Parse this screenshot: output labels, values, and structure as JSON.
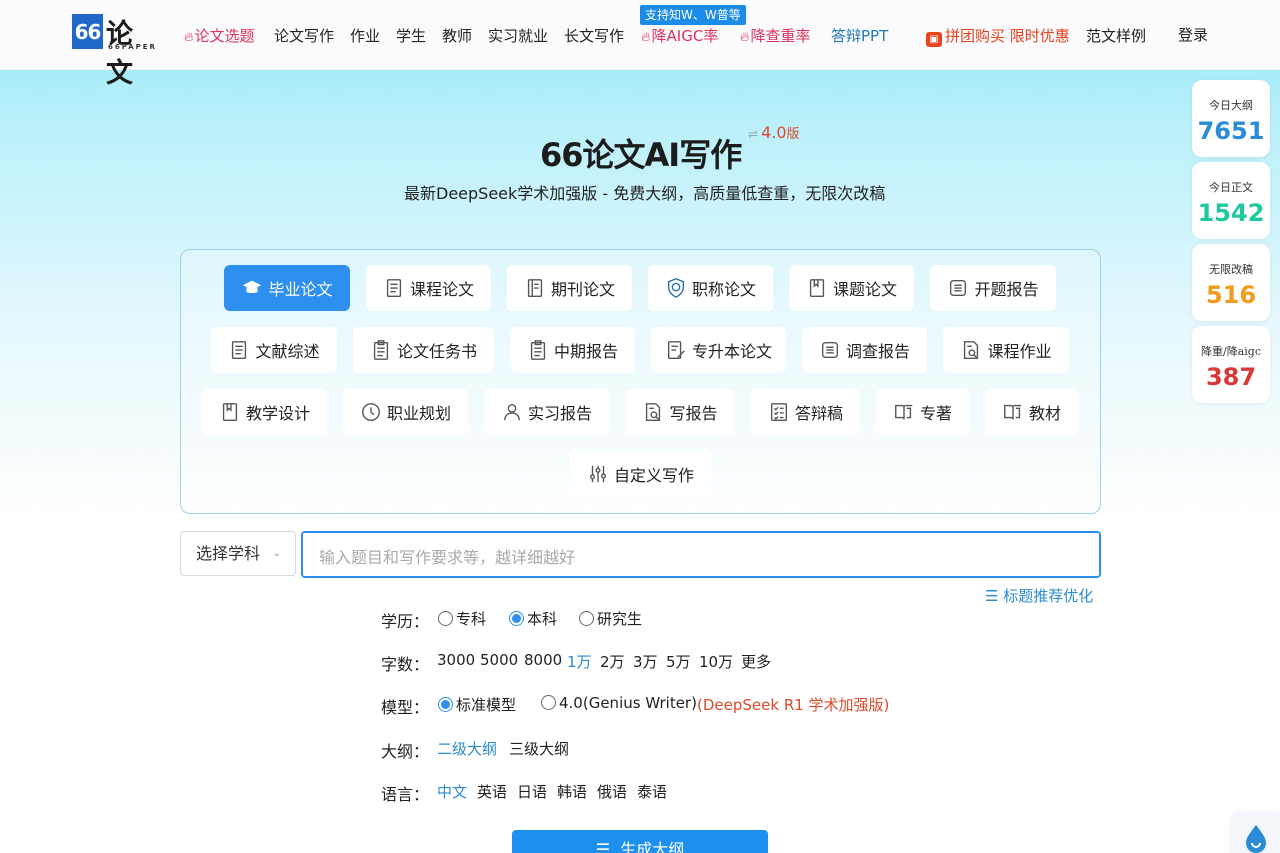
{
  "header": {
    "logo": {
      "mark": "66",
      "cn": "论文",
      "en": "66PAPER"
    },
    "nav": [
      {
        "label": "论文选题",
        "style": "hot",
        "flame": true
      },
      {
        "label": "论文写作"
      },
      {
        "label": "作业"
      },
      {
        "label": "学生"
      },
      {
        "label": "教师"
      },
      {
        "label": "实习就业"
      },
      {
        "label": "长文写作"
      },
      {
        "label": "降AIGC率",
        "style": "hot",
        "flame": true
      },
      {
        "label": "降查重率",
        "style": "hot",
        "flame": true
      },
      {
        "label": "答辩PPT",
        "style": "blue"
      },
      {
        "label": "拼团购买 限时优惠",
        "style": "promo",
        "gift": true
      },
      {
        "label": "范文样例"
      },
      {
        "label": "登录"
      }
    ],
    "badge": "支持知W、W普等"
  },
  "stats": [
    {
      "label": "今日大纲",
      "value": "7651",
      "color": "#2a8bd6"
    },
    {
      "label": "今日正文",
      "value": "1542",
      "color": "#1fc9a0"
    },
    {
      "label": "无限改稿",
      "value": "516",
      "color": "#f29a1c"
    },
    {
      "label": "降重/降aigc",
      "value": "387",
      "color": "#d93838"
    }
  ],
  "hero": {
    "title": "66论文AI写作",
    "version_switch": "⇌",
    "version": "4.0",
    "version_suffix": "版",
    "subtitle": "最新DeepSeek学术加强版 - 免费大纲，高质量低查重，无限次改稿"
  },
  "categories": [
    {
      "label": "毕业论文",
      "icon": "graduation-cap-icon",
      "active": true
    },
    {
      "label": "课程论文",
      "icon": "document-icon"
    },
    {
      "label": "期刊论文",
      "icon": "journal-icon"
    },
    {
      "label": "职称论文",
      "icon": "badge-shield-icon"
    },
    {
      "label": "课题论文",
      "icon": "bookmark-book-icon"
    },
    {
      "label": "开题报告",
      "icon": "report-icon"
    },
    {
      "label": "文献综述",
      "icon": "document-icon"
    },
    {
      "label": "论文任务书",
      "icon": "clipboard-icon"
    },
    {
      "label": "中期报告",
      "icon": "clipboard-icon"
    },
    {
      "label": "专升本论文",
      "icon": "edit-document-icon"
    },
    {
      "label": "调查报告",
      "icon": "report-icon"
    },
    {
      "label": "课程作业",
      "icon": "search-document-icon"
    },
    {
      "label": "教学设计",
      "icon": "bookmark-book-icon"
    },
    {
      "label": "职业规划",
      "icon": "clock-icon"
    },
    {
      "label": "实习报告",
      "icon": "user-icon"
    },
    {
      "label": "写报告",
      "icon": "search-document-icon"
    },
    {
      "label": "答辩稿",
      "icon": "checklist-icon"
    },
    {
      "label": "专著",
      "icon": "open-book-icon"
    },
    {
      "label": "教材",
      "icon": "open-book-icon"
    },
    {
      "label": "自定义写作",
      "icon": "sliders-icon"
    }
  ],
  "form": {
    "subject_select": "选择学科",
    "topic_placeholder": "输入题目和写作要求等，越详细越好",
    "title_optimize": "标题推荐优化",
    "education": {
      "label": "学历：",
      "options": [
        "专科",
        "本科",
        "研究生"
      ],
      "selected": "本科"
    },
    "word_count": {
      "label": "字数：",
      "options": [
        "3000",
        "5000",
        "8000",
        "1万",
        "2万",
        "3万",
        "5万",
        "10万",
        "更多"
      ],
      "selected": "1万"
    },
    "model": {
      "label": "模型：",
      "options": [
        "标准模型",
        "4.0(Genius Writer)"
      ],
      "selected": "标准模型",
      "note": "(DeepSeek R1 学术加强版)"
    },
    "outline": {
      "label": "大纲：",
      "options": [
        "二级大纲",
        "三级大纲"
      ],
      "selected": "二级大纲"
    },
    "language": {
      "label": "语言：",
      "options": [
        "中文",
        "英语",
        "日语",
        "韩语",
        "俄语",
        "泰语"
      ],
      "selected": "中文"
    },
    "generate_button": "生成大纲"
  }
}
